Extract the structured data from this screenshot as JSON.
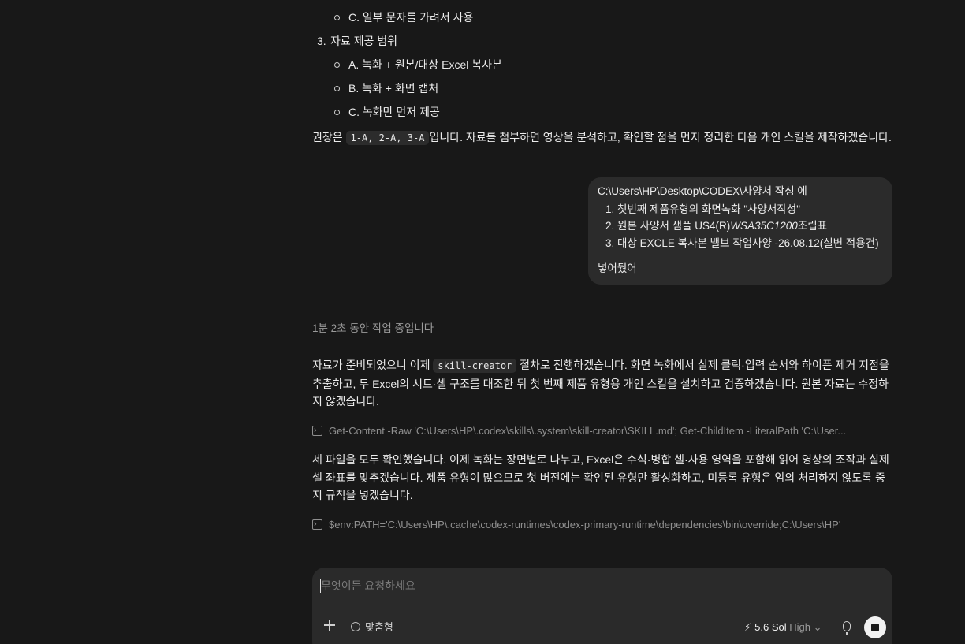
{
  "assistant_prev": {
    "line_1c": "C. 일부 문자를 가려서 사용",
    "item3_num": "3.",
    "item3_label": "자료 제공 범위",
    "opt_a": "A. 녹화 + 원본/대상 Excel 복사본",
    "opt_b": "B. 녹화 + 화면 캡처",
    "opt_c": "C. 녹화만 먼저 제공",
    "rec_prefix": "권장은",
    "rec_code": "1-A, 2-A, 3-A",
    "rec_suffix": "입니다. 자료를 첨부하면 영상을 분석하고, 확인할 점을 먼저 정리한 다음 개인 스킬을 제작하겠습니다."
  },
  "user_msg": {
    "path": "C:\\Users\\HP\\Desktop\\CODEX\\사양서 작성 에",
    "items": [
      {
        "num": "1.",
        "text": "첫번째 제품유형의 화면녹화 \"사양서작성\""
      },
      {
        "num": "2.",
        "text_a": "원본 사양서 샘플 US4(R)",
        "text_italic": "WSA35C1200",
        "text_b": "조립표"
      },
      {
        "num": "3.",
        "text": "대상 EXCLE 복사본  밸브 작업사양 -26.08.12(설변 적용건)"
      }
    ],
    "closing": "넣어뒀어"
  },
  "status": {
    "working": "1분 2초 동안 작업 중입니다"
  },
  "assistant_now": {
    "p1_a": "자료가 준비되었으니 이제",
    "p1_code": "skill-creator",
    "p1_b": "절차로 진행하겠습니다. 화면 녹화에서 실제 클릭·입력 순서와 하이픈 제거 지점을",
    "p1_line2": "추출하고, 두 Excel의 시트·셀 구조를 대조한 뒤 첫 번째 제품 유형용 개인 스킬을 설치하고 검증하겠습니다. 원본 자료는 수정하",
    "p1_line3": "지 않겠습니다.",
    "cmd1": "Get-Content -Raw 'C:\\Users\\HP\\.codex\\skills\\.system\\skill-creator\\SKILL.md'; Get-ChildItem -LiteralPath 'C:\\User...",
    "p2_line1": "세 파일을 모두 확인했습니다. 이제 녹화는 장면별로 나누고, Excel은 수식·병합 셀·사용 영역을 포함해 읽어 영상의 조작과 실제",
    "p2_line2": "셀 좌표를 맞추겠습니다. 제품 유형이 많으므로 첫 버전에는 확인된 유형만 활성화하고, 미등록 유형은 임의 처리하지 않도록 중",
    "p2_line3": "지 규칙을 넣겠습니다.",
    "cmd2": "$env:PATH='C:\\Users\\HP\\.cache\\codex-runtimes\\codex-primary-runtime\\dependencies\\bin\\override;C:\\Users\\HP'"
  },
  "composer": {
    "placeholder": "무엇이든 요청하세요",
    "custom_label": "맞춤형",
    "model_name": "5.6 Sol",
    "model_effort": "High",
    "chevron": "⌄",
    "bolt": "⚡"
  },
  "icons": [
    "plus-icon",
    "gear-icon",
    "bolt-icon",
    "chevron-down-icon",
    "mic-icon",
    "stop-icon",
    "terminal-icon"
  ]
}
